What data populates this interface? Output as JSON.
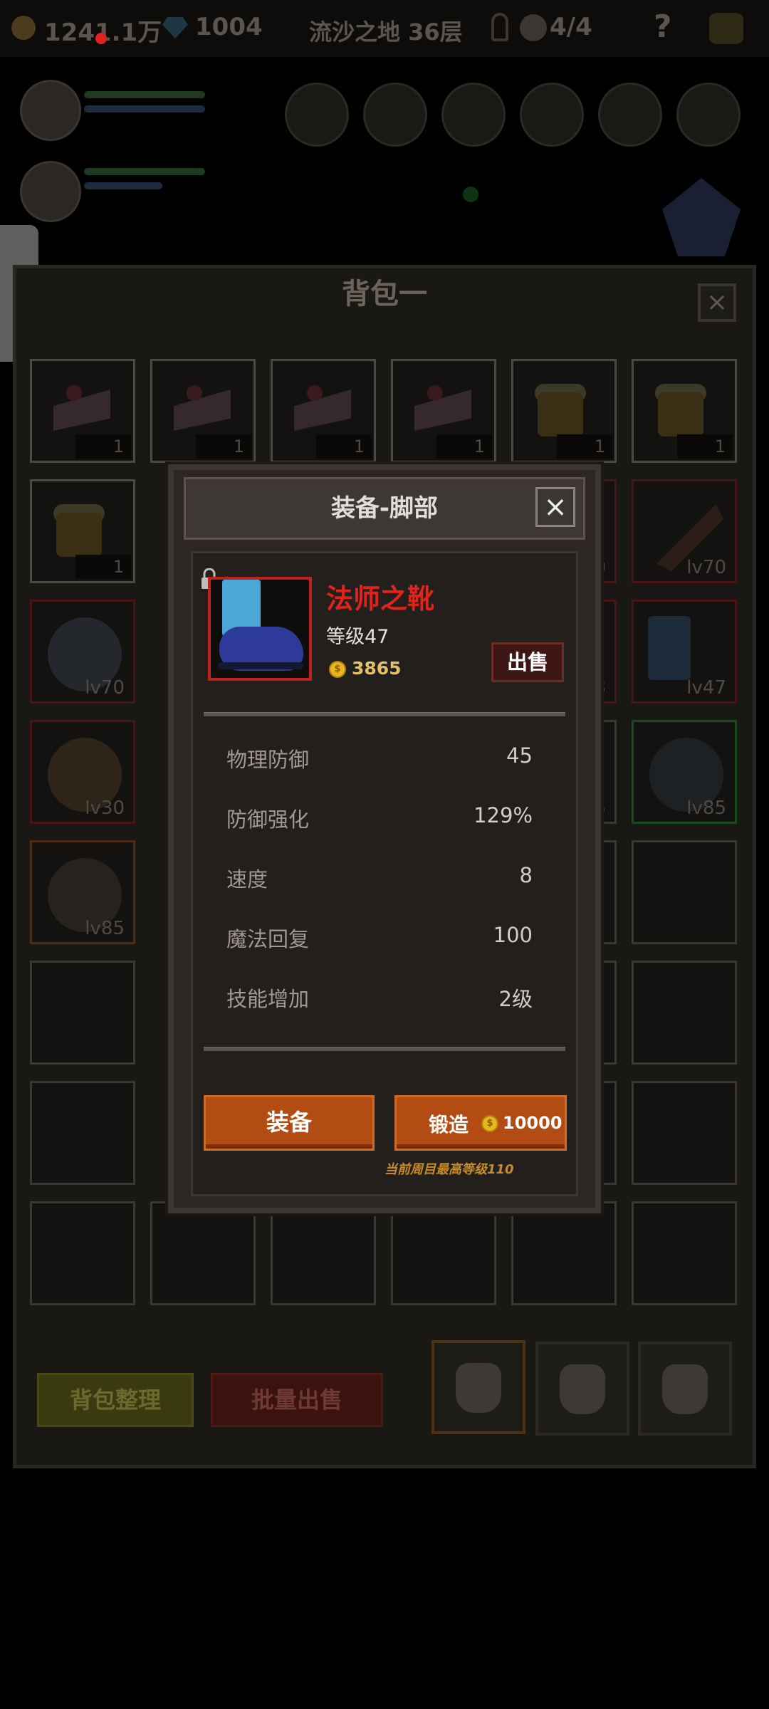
{
  "hud": {
    "gold": "1241.1万",
    "gems": "1004",
    "location": "流沙之地 36层",
    "keys_skulls": "4/4",
    "help": "?"
  },
  "backpack": {
    "title": "背包一",
    "close": "×",
    "rows": [
      [
        "1",
        "1",
        "1",
        "1",
        "1",
        "1"
      ],
      [
        "1",
        "",
        "",
        "",
        "0",
        "lv70"
      ],
      [
        "lv70",
        "",
        "",
        "",
        "3",
        "lv47"
      ],
      [
        "lv30",
        "",
        "",
        "",
        "5",
        "lv85"
      ],
      [
        "lv85",
        "",
        "",
        "",
        "",
        ""
      ]
    ],
    "sort_button": "背包整理",
    "bulk_sell_button": "批量出售"
  },
  "modal": {
    "title": "装备-脚部",
    "close": "×",
    "item": {
      "name": "法师之靴",
      "level": "等级47",
      "price": "3865",
      "sell_button": "出售"
    },
    "stats": [
      {
        "name": "物理防御",
        "value": "45"
      },
      {
        "name": "防御强化",
        "value": "129%"
      },
      {
        "name": "速度",
        "value": "8"
      },
      {
        "name": "魔法回复",
        "value": "100"
      },
      {
        "name": "技能增加",
        "value": "2级"
      }
    ],
    "equip_button": "装备",
    "forge_button": "锻造",
    "forge_cost": "10000",
    "note": "当前周目最高等级110"
  },
  "colors": {
    "accent_orange": "#b34c12",
    "item_name_red": "#e0231b",
    "price_gold": "#e3c16b"
  }
}
